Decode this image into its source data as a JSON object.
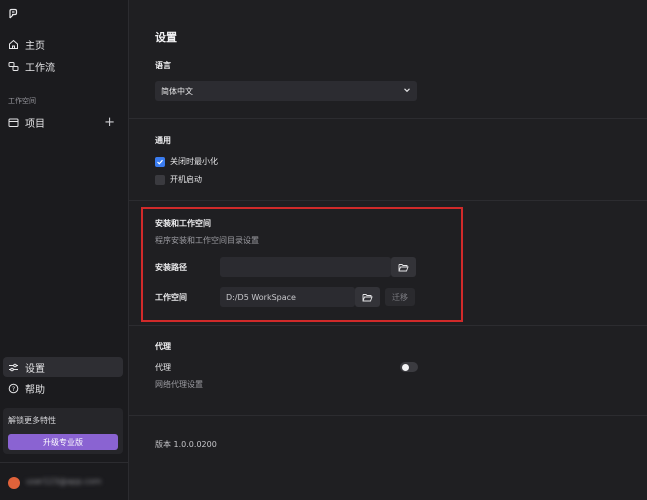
{
  "sidebar": {
    "home_label": "主页",
    "workflow_label": "工作流",
    "workspace_section": "工作空间",
    "projects_label": "项目",
    "settings_label": "设置",
    "help_label": "帮助",
    "upgrade_title": "解锁更多特性",
    "upgrade_button": "升级专业版",
    "user_name": "user123@app.com"
  },
  "settings": {
    "title": "设置",
    "language": {
      "title": "语言",
      "selected": "简体中文"
    },
    "general": {
      "title": "通用",
      "minimize_on_close": "关闭时最小化",
      "minimize_on_close_checked": true,
      "launch_at_startup": "开机启动",
      "launch_at_startup_checked": false
    },
    "install": {
      "title": "安装和工作空间",
      "description": "程序安装和工作空间目录设置",
      "install_path_label": "安装路径",
      "install_path_value": "",
      "workspace_label": "工作空间",
      "workspace_value": "D:/D5 WorkSpace",
      "migrate_button": "迁移"
    },
    "proxy": {
      "title": "代理",
      "proxy_label": "代理",
      "proxy_description": "网络代理设置",
      "proxy_enabled": false
    },
    "version": "版本 1.0.0.0200"
  },
  "colors": {
    "accent": "#8a63d2",
    "checkbox_on": "#3a7cf0",
    "highlight": "#d12a2a"
  }
}
